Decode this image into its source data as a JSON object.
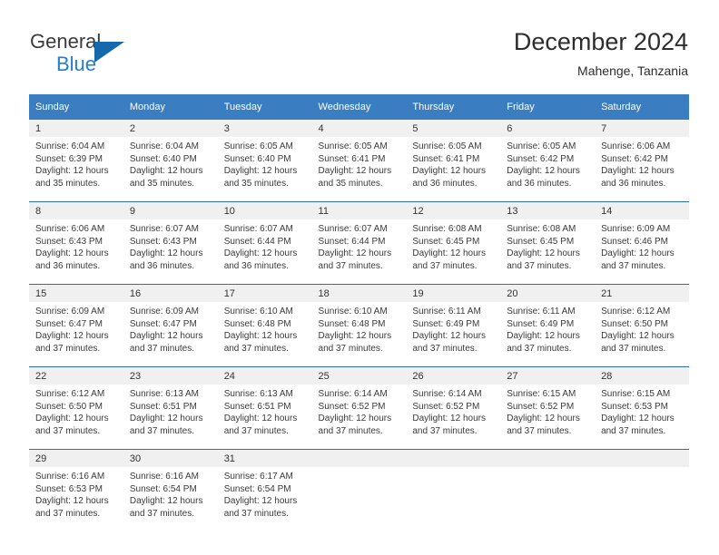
{
  "brand": {
    "name_part1": "General",
    "name_part2": "Blue",
    "logo_icon": "triangle-logo-icon"
  },
  "header": {
    "title": "December 2024",
    "subtitle": "Mahenge, Tanzania"
  },
  "colors": {
    "header_blue": "#3a7dc0",
    "row_divider_blue": "#2f6ea8",
    "daynum_band": "#f0f0f0",
    "brand_blue": "#1f7fd0",
    "text": "#3a3a3a"
  },
  "weekday_headers": [
    "Sunday",
    "Monday",
    "Tuesday",
    "Wednesday",
    "Thursday",
    "Friday",
    "Saturday"
  ],
  "weeks": [
    [
      {
        "day": "1",
        "sunrise": "Sunrise: 6:04 AM",
        "sunset": "Sunset: 6:39 PM",
        "daylight": "Daylight: 12 hours and 35 minutes."
      },
      {
        "day": "2",
        "sunrise": "Sunrise: 6:04 AM",
        "sunset": "Sunset: 6:40 PM",
        "daylight": "Daylight: 12 hours and 35 minutes."
      },
      {
        "day": "3",
        "sunrise": "Sunrise: 6:05 AM",
        "sunset": "Sunset: 6:40 PM",
        "daylight": "Daylight: 12 hours and 35 minutes."
      },
      {
        "day": "4",
        "sunrise": "Sunrise: 6:05 AM",
        "sunset": "Sunset: 6:41 PM",
        "daylight": "Daylight: 12 hours and 35 minutes."
      },
      {
        "day": "5",
        "sunrise": "Sunrise: 6:05 AM",
        "sunset": "Sunset: 6:41 PM",
        "daylight": "Daylight: 12 hours and 36 minutes."
      },
      {
        "day": "6",
        "sunrise": "Sunrise: 6:05 AM",
        "sunset": "Sunset: 6:42 PM",
        "daylight": "Daylight: 12 hours and 36 minutes."
      },
      {
        "day": "7",
        "sunrise": "Sunrise: 6:06 AM",
        "sunset": "Sunset: 6:42 PM",
        "daylight": "Daylight: 12 hours and 36 minutes."
      }
    ],
    [
      {
        "day": "8",
        "sunrise": "Sunrise: 6:06 AM",
        "sunset": "Sunset: 6:43 PM",
        "daylight": "Daylight: 12 hours and 36 minutes."
      },
      {
        "day": "9",
        "sunrise": "Sunrise: 6:07 AM",
        "sunset": "Sunset: 6:43 PM",
        "daylight": "Daylight: 12 hours and 36 minutes."
      },
      {
        "day": "10",
        "sunrise": "Sunrise: 6:07 AM",
        "sunset": "Sunset: 6:44 PM",
        "daylight": "Daylight: 12 hours and 36 minutes."
      },
      {
        "day": "11",
        "sunrise": "Sunrise: 6:07 AM",
        "sunset": "Sunset: 6:44 PM",
        "daylight": "Daylight: 12 hours and 37 minutes."
      },
      {
        "day": "12",
        "sunrise": "Sunrise: 6:08 AM",
        "sunset": "Sunset: 6:45 PM",
        "daylight": "Daylight: 12 hours and 37 minutes."
      },
      {
        "day": "13",
        "sunrise": "Sunrise: 6:08 AM",
        "sunset": "Sunset: 6:45 PM",
        "daylight": "Daylight: 12 hours and 37 minutes."
      },
      {
        "day": "14",
        "sunrise": "Sunrise: 6:09 AM",
        "sunset": "Sunset: 6:46 PM",
        "daylight": "Daylight: 12 hours and 37 minutes."
      }
    ],
    [
      {
        "day": "15",
        "sunrise": "Sunrise: 6:09 AM",
        "sunset": "Sunset: 6:47 PM",
        "daylight": "Daylight: 12 hours and 37 minutes."
      },
      {
        "day": "16",
        "sunrise": "Sunrise: 6:09 AM",
        "sunset": "Sunset: 6:47 PM",
        "daylight": "Daylight: 12 hours and 37 minutes."
      },
      {
        "day": "17",
        "sunrise": "Sunrise: 6:10 AM",
        "sunset": "Sunset: 6:48 PM",
        "daylight": "Daylight: 12 hours and 37 minutes."
      },
      {
        "day": "18",
        "sunrise": "Sunrise: 6:10 AM",
        "sunset": "Sunset: 6:48 PM",
        "daylight": "Daylight: 12 hours and 37 minutes."
      },
      {
        "day": "19",
        "sunrise": "Sunrise: 6:11 AM",
        "sunset": "Sunset: 6:49 PM",
        "daylight": "Daylight: 12 hours and 37 minutes."
      },
      {
        "day": "20",
        "sunrise": "Sunrise: 6:11 AM",
        "sunset": "Sunset: 6:49 PM",
        "daylight": "Daylight: 12 hours and 37 minutes."
      },
      {
        "day": "21",
        "sunrise": "Sunrise: 6:12 AM",
        "sunset": "Sunset: 6:50 PM",
        "daylight": "Daylight: 12 hours and 37 minutes."
      }
    ],
    [
      {
        "day": "22",
        "sunrise": "Sunrise: 6:12 AM",
        "sunset": "Sunset: 6:50 PM",
        "daylight": "Daylight: 12 hours and 37 minutes."
      },
      {
        "day": "23",
        "sunrise": "Sunrise: 6:13 AM",
        "sunset": "Sunset: 6:51 PM",
        "daylight": "Daylight: 12 hours and 37 minutes."
      },
      {
        "day": "24",
        "sunrise": "Sunrise: 6:13 AM",
        "sunset": "Sunset: 6:51 PM",
        "daylight": "Daylight: 12 hours and 37 minutes."
      },
      {
        "day": "25",
        "sunrise": "Sunrise: 6:14 AM",
        "sunset": "Sunset: 6:52 PM",
        "daylight": "Daylight: 12 hours and 37 minutes."
      },
      {
        "day": "26",
        "sunrise": "Sunrise: 6:14 AM",
        "sunset": "Sunset: 6:52 PM",
        "daylight": "Daylight: 12 hours and 37 minutes."
      },
      {
        "day": "27",
        "sunrise": "Sunrise: 6:15 AM",
        "sunset": "Sunset: 6:52 PM",
        "daylight": "Daylight: 12 hours and 37 minutes."
      },
      {
        "day": "28",
        "sunrise": "Sunrise: 6:15 AM",
        "sunset": "Sunset: 6:53 PM",
        "daylight": "Daylight: 12 hours and 37 minutes."
      }
    ],
    [
      {
        "day": "29",
        "sunrise": "Sunrise: 6:16 AM",
        "sunset": "Sunset: 6:53 PM",
        "daylight": "Daylight: 12 hours and 37 minutes."
      },
      {
        "day": "30",
        "sunrise": "Sunrise: 6:16 AM",
        "sunset": "Sunset: 6:54 PM",
        "daylight": "Daylight: 12 hours and 37 minutes."
      },
      {
        "day": "31",
        "sunrise": "Sunrise: 6:17 AM",
        "sunset": "Sunset: 6:54 PM",
        "daylight": "Daylight: 12 hours and 37 minutes."
      },
      {
        "day": "",
        "sunrise": "",
        "sunset": "",
        "daylight": ""
      },
      {
        "day": "",
        "sunrise": "",
        "sunset": "",
        "daylight": ""
      },
      {
        "day": "",
        "sunrise": "",
        "sunset": "",
        "daylight": ""
      },
      {
        "day": "",
        "sunrise": "",
        "sunset": "",
        "daylight": ""
      }
    ]
  ]
}
